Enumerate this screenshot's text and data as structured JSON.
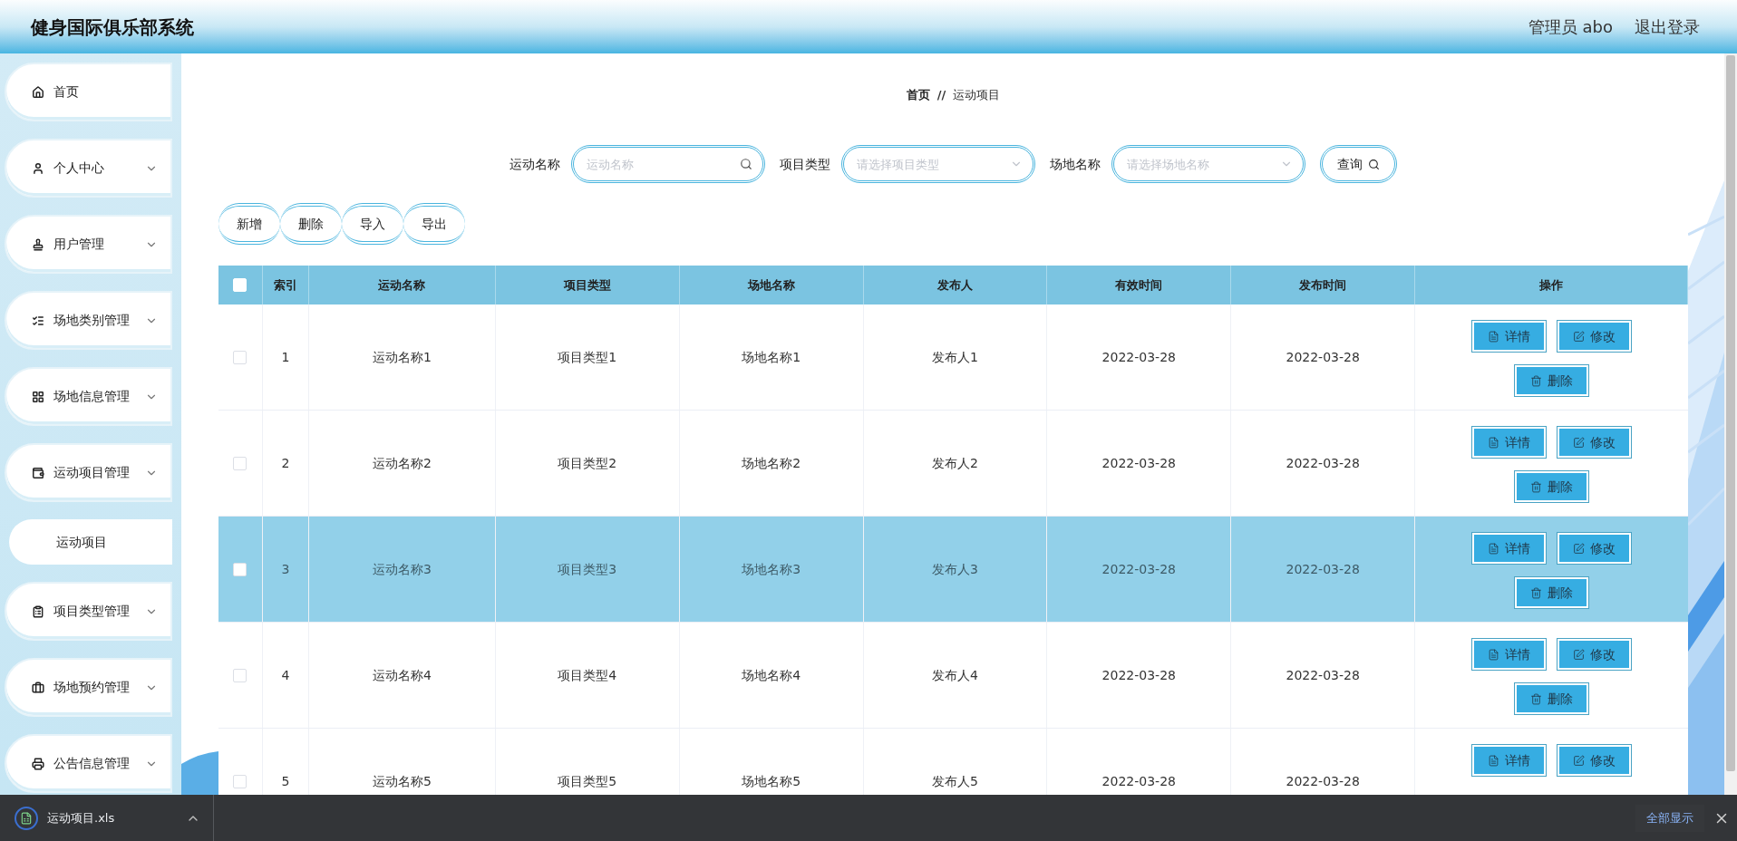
{
  "header": {
    "title": "健身国际俱乐部系统",
    "user": "管理员 abo",
    "logout": "退出登录"
  },
  "sidebar": {
    "items": [
      {
        "label": "首页",
        "kind": "link"
      },
      {
        "label": "个人中心",
        "kind": "menu"
      },
      {
        "label": "用户管理",
        "kind": "menu"
      },
      {
        "label": "场地类别管理",
        "kind": "menu"
      },
      {
        "label": "场地信息管理",
        "kind": "menu"
      },
      {
        "label": "运动项目管理",
        "kind": "menu",
        "children": [
          {
            "label": "运动项目"
          }
        ]
      },
      {
        "label": "项目类型管理",
        "kind": "menu"
      },
      {
        "label": "场地预约管理",
        "kind": "menu"
      },
      {
        "label": "公告信息管理",
        "kind": "menu"
      }
    ]
  },
  "breadcrumb": {
    "items": [
      "首页",
      "运动项目"
    ],
    "separator": "//"
  },
  "search": {
    "fields": [
      {
        "label": "运动名称",
        "placeholder": "运动名称",
        "kind": "text"
      },
      {
        "label": "项目类型",
        "placeholder": "请选择项目类型",
        "kind": "select"
      },
      {
        "label": "场地名称",
        "placeholder": "请选择场地名称",
        "kind": "select"
      }
    ],
    "button": "查询"
  },
  "toolbar": [
    "新增",
    "删除",
    "导入",
    "导出"
  ],
  "table": {
    "header_checked": false,
    "columns": [
      "索引",
      "运动名称",
      "项目类型",
      "场地名称",
      "发布人",
      "有效时间",
      "发布时间",
      "操作"
    ],
    "rows": [
      {
        "checked": false,
        "selected": false,
        "cells": [
          "1",
          "运动名称1",
          "项目类型1",
          "场地名称1",
          "发布人1",
          "2022-03-28",
          "2022-03-28"
        ],
        "actions": [
          {
            "label": "详情",
            "kind": "detail"
          },
          {
            "label": "修改",
            "kind": "edit"
          },
          {
            "label": "删除",
            "kind": "delete"
          }
        ]
      },
      {
        "checked": false,
        "selected": false,
        "cells": [
          "2",
          "运动名称2",
          "项目类型2",
          "场地名称2",
          "发布人2",
          "2022-03-28",
          "2022-03-28"
        ],
        "actions": [
          {
            "label": "详情",
            "kind": "detail"
          },
          {
            "label": "修改",
            "kind": "edit"
          },
          {
            "label": "删除",
            "kind": "delete"
          }
        ]
      },
      {
        "checked": false,
        "selected": true,
        "cells": [
          "3",
          "运动名称3",
          "项目类型3",
          "场地名称3",
          "发布人3",
          "2022-03-28",
          "2022-03-28"
        ],
        "actions": [
          {
            "label": "详情",
            "kind": "detail"
          },
          {
            "label": "修改",
            "kind": "edit"
          },
          {
            "label": "删除",
            "kind": "delete"
          }
        ]
      },
      {
        "checked": false,
        "selected": false,
        "cells": [
          "4",
          "运动名称4",
          "项目类型4",
          "场地名称4",
          "发布人4",
          "2022-03-28",
          "2022-03-28"
        ],
        "actions": [
          {
            "label": "详情",
            "kind": "detail"
          },
          {
            "label": "修改",
            "kind": "edit"
          },
          {
            "label": "删除",
            "kind": "delete"
          }
        ]
      },
      {
        "checked": false,
        "selected": false,
        "cells": [
          "5",
          "运动名称5",
          "项目类型5",
          "场地名称5",
          "发布人5",
          "2022-03-28",
          "2022-03-28"
        ],
        "actions": [
          {
            "label": "详情",
            "kind": "detail"
          },
          {
            "label": "修改",
            "kind": "edit"
          }
        ]
      }
    ]
  },
  "download_bar": {
    "file": "运动项目.xls",
    "show_all": "全部显示"
  }
}
